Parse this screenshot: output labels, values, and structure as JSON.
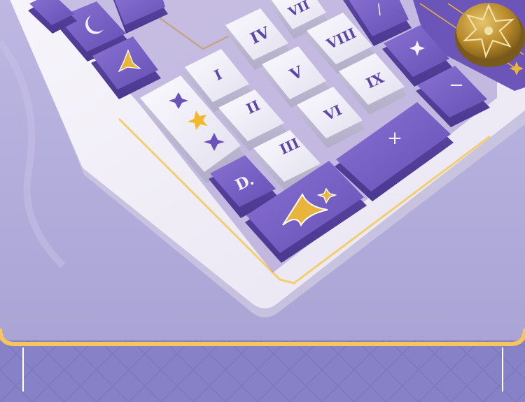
{
  "image": {
    "kind": "product-photo",
    "subject": "purple and white themed mechanical keyboard, numpad corner",
    "colors": {
      "background_top": "#b7b1de",
      "background_bottom": "#aea8d9",
      "keyboard_case": "#f1eef6",
      "case_shadow": "#c7c2dc",
      "key_purple": "#7b63c6",
      "key_purple_dark": "#5d47a6",
      "key_white": "#f3f1f8",
      "legend_purple": "#5b45a8",
      "gold": "#e9b43c",
      "footer_band": "#8580c4",
      "footer_pattern": "#7a75ba",
      "footer_border": "#f6c65a"
    }
  },
  "keycaps": [
    {
      "name": "moon-key",
      "style": "purple",
      "legend": "moon-icon"
    },
    {
      "name": "sparkle-key",
      "style": "purple",
      "legend": "gold-diamond-icon"
    },
    {
      "name": "decor-key",
      "style": "white",
      "legend": "stars-icon"
    },
    {
      "name": "num-1",
      "style": "white",
      "legend": "I"
    },
    {
      "name": "num-2",
      "style": "white",
      "legend": "II"
    },
    {
      "name": "num-3",
      "style": "white",
      "legend": "III"
    },
    {
      "name": "num-4",
      "style": "white",
      "legend": "IV"
    },
    {
      "name": "num-5",
      "style": "white",
      "legend": "V"
    },
    {
      "name": "num-6",
      "style": "white",
      "legend": "VI"
    },
    {
      "name": "num-7",
      "style": "white",
      "legend": "VII"
    },
    {
      "name": "num-8",
      "style": "white",
      "legend": "VIII"
    },
    {
      "name": "num-9",
      "style": "white",
      "legend": "IX"
    },
    {
      "name": "dot-key",
      "style": "purple",
      "legend": "D."
    },
    {
      "name": "zero-key",
      "style": "purple",
      "legend": "gold-diamond-icon"
    },
    {
      "name": "plus-key",
      "style": "purple",
      "legend": "+"
    },
    {
      "name": "minus-key",
      "style": "purple",
      "legend": "−"
    },
    {
      "name": "star-key",
      "style": "purple",
      "legend": "sparkle-icon"
    },
    {
      "name": "slash-key",
      "style": "purple",
      "legend": "/"
    }
  ],
  "knob": {
    "legend": "hexagram-icon",
    "color": "#c49a36"
  }
}
